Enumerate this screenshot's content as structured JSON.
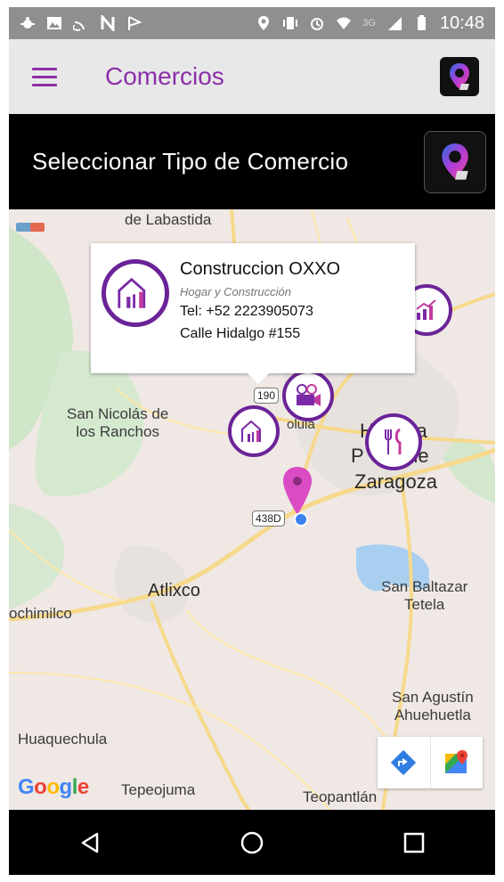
{
  "status_bar": {
    "time": "10:48",
    "network": "3G"
  },
  "app_bar": {
    "title": "Comercios"
  },
  "selector": {
    "label": "Seleccionar Tipo de Comercio"
  },
  "map": {
    "places": {
      "labastida": "de Labastida",
      "san_nicolas": "San Nicolás de\nlos Ranchos",
      "cholula": "olula",
      "heroica": "H      ca",
      "puebla": "P        de",
      "zaragoza": "Zaragoza",
      "atlixco": "Atlixco",
      "xochimilco": "ochimilco",
      "san_baltazar": "San Baltazar\nTetela",
      "san_agustin": "San Agustín\nAhuehuetla",
      "huaquechula": "Huaquechula",
      "tepeojuma": "Tepeojuma",
      "teopantlan": "Teopantlán"
    },
    "shields": {
      "r190": "190",
      "r438d": "438D"
    },
    "popup": {
      "name": "Construccion OXXO",
      "category": "Hogar y Construcción",
      "tel": "Tel: +52 2223905073",
      "address": "Calle Hidalgo #155"
    },
    "attribution": "Google"
  },
  "colors": {
    "brand_purple": "#8b2fa8",
    "poi_border": "#6b2398",
    "pin": "#d94cc4"
  }
}
